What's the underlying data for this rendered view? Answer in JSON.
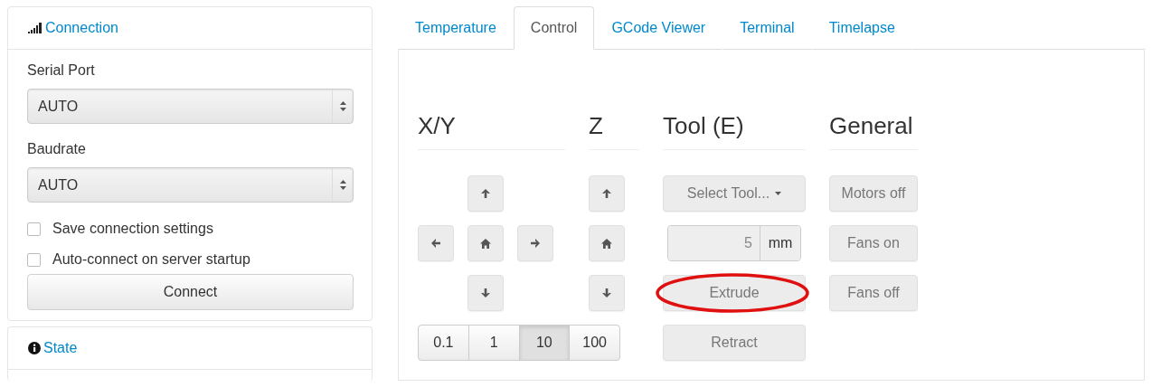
{
  "sidebar": {
    "connection": {
      "title": "Connection",
      "fields": [
        {
          "label": "Serial Port",
          "value": "AUTO"
        },
        {
          "label": "Baudrate",
          "value": "AUTO"
        }
      ],
      "options": [
        {
          "label": "Save connection settings",
          "checked": false
        },
        {
          "label": "Auto-connect on server startup",
          "checked": false
        }
      ],
      "button": "Connect"
    },
    "state": {
      "title": "State"
    }
  },
  "tabs": [
    {
      "label": "Temperature",
      "selected": false
    },
    {
      "label": "Control",
      "selected": true
    },
    {
      "label": "GCode Viewer",
      "selected": false
    },
    {
      "label": "Terminal",
      "selected": false
    },
    {
      "label": "Timelapse",
      "selected": false
    }
  ],
  "control": {
    "disabled": true,
    "xy": {
      "title": "X/Y",
      "steps": [
        {
          "label": "0.1",
          "selected": false
        },
        {
          "label": "1",
          "selected": false
        },
        {
          "label": "10",
          "selected": true
        },
        {
          "label": "100",
          "selected": false
        }
      ]
    },
    "z": {
      "title": "Z"
    },
    "tool": {
      "title": "Tool (E)",
      "select": "Select Tool...",
      "amount": "5",
      "unit": "mm",
      "buttons": [
        "Extrude",
        "Retract"
      ]
    },
    "general": {
      "title": "General",
      "buttons": [
        "Motors off",
        "Fans on",
        "Fans off"
      ]
    }
  }
}
